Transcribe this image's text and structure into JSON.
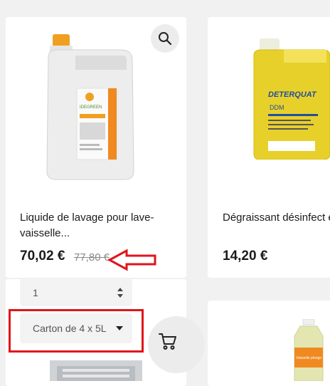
{
  "products": [
    {
      "title": "Liquide de lavage pour lave-vaisselle...",
      "price": "70,02 €",
      "old_price": "77,80 €",
      "brand_label": "IDEGREEN",
      "quantity": "1",
      "variant": "Carton de 4 x 5L"
    },
    {
      "title": "Dégraissant désinfect et...",
      "price": "14,20 €",
      "brand_label": "DETERQUAT",
      "sub_label": "DDM"
    },
    {},
    {
      "label": "Vaisselle plonge 14"
    }
  ],
  "icons": {
    "search": "search-icon",
    "cart": "cart-icon",
    "annotation": "red-arrow",
    "spinner": "spinner-arrows-icon",
    "caret": "caret-down-icon"
  },
  "colors": {
    "annotation_red": "#e0141b",
    "card_bg": "#ffffff",
    "page_bg": "#f1f1f1",
    "jerrycan_yellow": "#e8d02a",
    "cap_orange": "#f0a020"
  }
}
